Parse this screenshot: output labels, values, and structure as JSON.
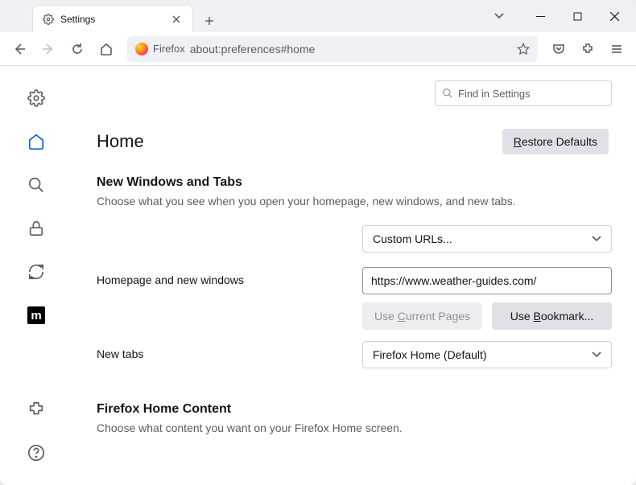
{
  "tab": {
    "title": "Settings"
  },
  "urlbar": {
    "identity": "Firefox",
    "url": "about:preferences#home"
  },
  "search": {
    "placeholder": "Find in Settings"
  },
  "page": {
    "title": "Home",
    "restore_btn": "estore Defaults",
    "section1": {
      "heading": "New Windows and Tabs",
      "desc": "Choose what you see when you open your homepage, new windows, and new tabs."
    },
    "homepage_select": "Custom URLs...",
    "homepage_label": "Homepage and new windows",
    "homepage_url": "https://www.weather-guides.com/",
    "use_current": "urrent Pages",
    "use_bookmark": "ookmark...",
    "newtabs_label": "New tabs",
    "newtabs_select": "Firefox Home (Default)",
    "section2": {
      "heading": "Firefox Home Content",
      "desc": "Choose what content you want on your Firefox Home screen."
    }
  }
}
